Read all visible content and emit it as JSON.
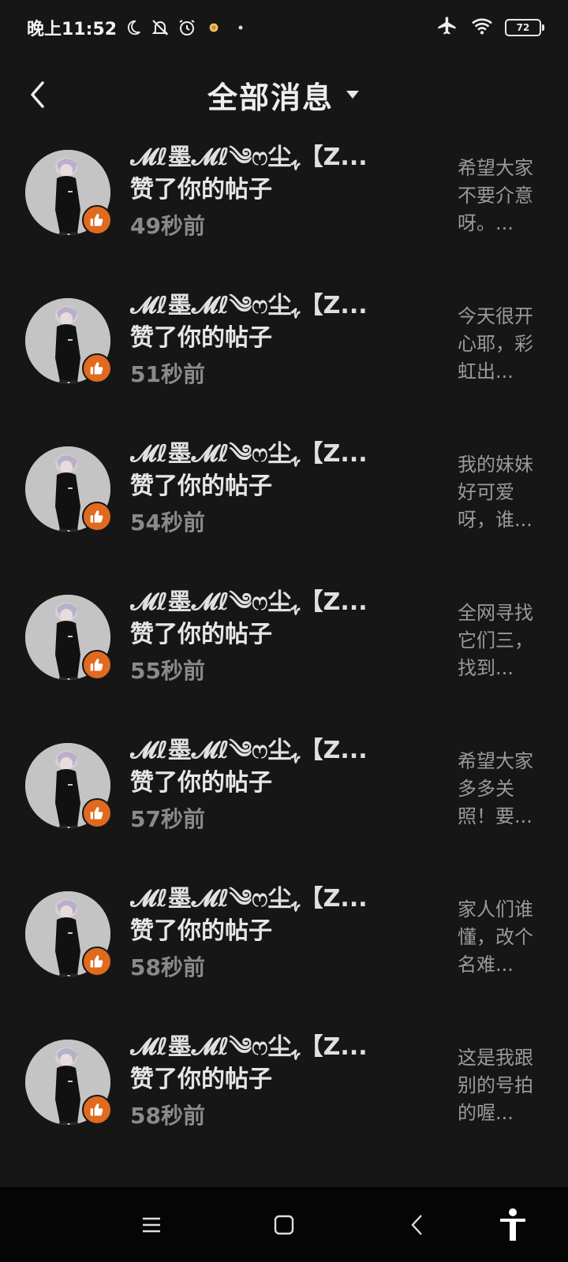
{
  "status_bar": {
    "time": "晚上11:52",
    "battery": "72",
    "icons": [
      "moon-icon",
      "bell-off-icon",
      "alarm-icon",
      "flower-icon",
      "dot-icon",
      "airplane-icon",
      "wifi-icon",
      "battery-icon"
    ]
  },
  "header": {
    "title": "全部消息",
    "back_icon": "chevron-left-icon",
    "dropdown_icon": "caret-down-icon"
  },
  "messages": [
    {
      "username": "𝓜ℓ墨𝓜ℓ༄ෆ尘ﮩ【Z...",
      "action": "赞了你的帖子",
      "time": "49秒前",
      "preview": "希望大家不要介意呀。..."
    },
    {
      "username": "𝓜ℓ墨𝓜ℓ༄ෆ尘ﮩ【Z...",
      "action": "赞了你的帖子",
      "time": "51秒前",
      "preview": "今天很开心耶，彩虹出..."
    },
    {
      "username": "𝓜ℓ墨𝓜ℓ༄ෆ尘ﮩ【Z...",
      "action": "赞了你的帖子",
      "time": "54秒前",
      "preview": "我的妹妹好可爱呀，谁..."
    },
    {
      "username": "𝓜ℓ墨𝓜ℓ༄ෆ尘ﮩ【Z...",
      "action": "赞了你的帖子",
      "time": "55秒前",
      "preview": "全网寻找它们三，找到..."
    },
    {
      "username": "𝓜ℓ墨𝓜ℓ༄ෆ尘ﮩ【Z...",
      "action": "赞了你的帖子",
      "time": "57秒前",
      "preview": "希望大家多多关照！要..."
    },
    {
      "username": "𝓜ℓ墨𝓜ℓ༄ෆ尘ﮩ【Z...",
      "action": "赞了你的帖子",
      "time": "58秒前",
      "preview": "家人们谁懂，改个名难..."
    },
    {
      "username": "𝓜ℓ墨𝓜ℓ༄ෆ尘ﮩ【Z...",
      "action": "赞了你的帖子",
      "time": "58秒前",
      "preview": "这是我跟别的号拍的喔..."
    }
  ],
  "nav_bar": {
    "icons": [
      "menu-icon",
      "home-square-icon",
      "back-triangle-icon",
      "accessibility-icon"
    ]
  },
  "colors": {
    "background": "#161616",
    "like_badge": "#e06a1f",
    "time_text": "#8a8a8a",
    "nav_bar": "#050505"
  }
}
